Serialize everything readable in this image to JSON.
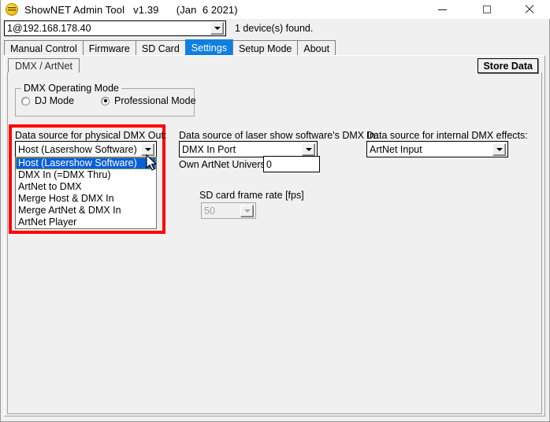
{
  "window": {
    "title": "ShowNET Admin Tool   v1.39      (Jan  6 2021)",
    "icon": "shownet-logo-icon",
    "controls": {
      "minimize": "minimize-icon",
      "maximize": "maximize-icon",
      "close": "close-icon"
    }
  },
  "toolbar": {
    "address_value": "1@192.168.178.40",
    "address_placeholder": "",
    "device_status": "1 device(s) found."
  },
  "tabs": [
    {
      "label": "Manual Control",
      "selected": false
    },
    {
      "label": "Firmware",
      "selected": false
    },
    {
      "label": "SD Card",
      "selected": false
    },
    {
      "label": "Settings",
      "selected": true
    },
    {
      "label": "Setup Mode",
      "selected": false
    },
    {
      "label": "About",
      "selected": false
    }
  ],
  "subtabs": [
    {
      "label": "DMX / ArtNet",
      "selected": true
    }
  ],
  "actions": {
    "store_data_label": "Store Data"
  },
  "operating_mode": {
    "legend": "DMX Operating Mode",
    "options": [
      {
        "label": "DJ Mode",
        "checked": false
      },
      {
        "label": "Professional Mode",
        "checked": true
      }
    ]
  },
  "physical_dmx_out": {
    "label": "Data source for physical DMX Out:",
    "value": "Host (Lasershow Software)",
    "open": true,
    "options": [
      {
        "label": "Host (Lasershow Software)",
        "selected": true
      },
      {
        "label": "DMX In (=DMX Thru)",
        "selected": false
      },
      {
        "label": "ArtNet to DMX",
        "selected": false
      },
      {
        "label": "Merge Host & DMX In",
        "selected": false
      },
      {
        "label": "Merge ArtNet & DMX In",
        "selected": false
      },
      {
        "label": "ArtNet Player",
        "selected": false
      }
    ]
  },
  "software_dmx_in": {
    "label": "Data source of laser show software's DMX In:",
    "value": "DMX In Port"
  },
  "artnet_universe": {
    "label": "Own ArtNet Universe",
    "value": "0"
  },
  "sd_frame_rate": {
    "label": "SD card frame rate [fps]",
    "value": "50",
    "disabled": true
  },
  "internal_dmx_effects": {
    "label": "Data source for internal DMX effects:",
    "value": "ArtNet Input"
  },
  "annotation": {
    "highlight_color": "#ff0000",
    "highlight_target": "physical-dmx-out-dropdown"
  },
  "colors": {
    "accent_tab": "#0f7fe0",
    "list_selection": "#0a5fd6",
    "window_background": "#f0f0f0",
    "highlight": "#ff0000"
  }
}
